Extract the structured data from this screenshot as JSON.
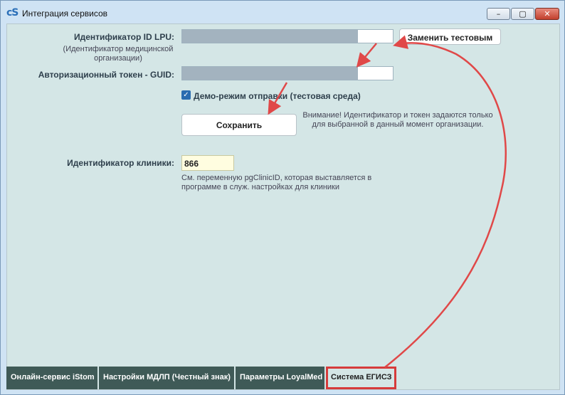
{
  "window": {
    "app_icon": "cS",
    "title": "Интеграция сервисов",
    "controls": {
      "minimize": "–",
      "maximize": "▢",
      "close": "✕"
    }
  },
  "form": {
    "lpu_label": "Идентификатор ID LPU:",
    "lpu_note": "(Идентификатор медицинской организации)",
    "lpu_value": "",
    "replace_button": "Заменить тестовым",
    "token_label": "Авторизационный токен - GUID:",
    "token_value": "",
    "demo_checkbox_label": "Демо-режим отправки  (тестовая среда)",
    "demo_checked": true,
    "save_button": "Сохранить",
    "warning": "Внимание! Идентификатор и токен задаются только для выбранной в данный момент организации.",
    "clinic_label": "Идентификатор клиники:",
    "clinic_value": "866",
    "clinic_note": "См. переменную pgClinicID, которая выставляется в программе  в служ. настройках для клиники"
  },
  "tabs": [
    {
      "label": "Онлайн-сервис iStom"
    },
    {
      "label": "Настройки МДЛП (Честный знак)"
    },
    {
      "label": "Параметры LoyalMed"
    },
    {
      "label": "Система ЕГИСЗ",
      "active": true
    }
  ],
  "colors": {
    "annotation": "#e04848",
    "tab_bg": "#3f5a57",
    "checkbox": "#2a6cb0"
  }
}
